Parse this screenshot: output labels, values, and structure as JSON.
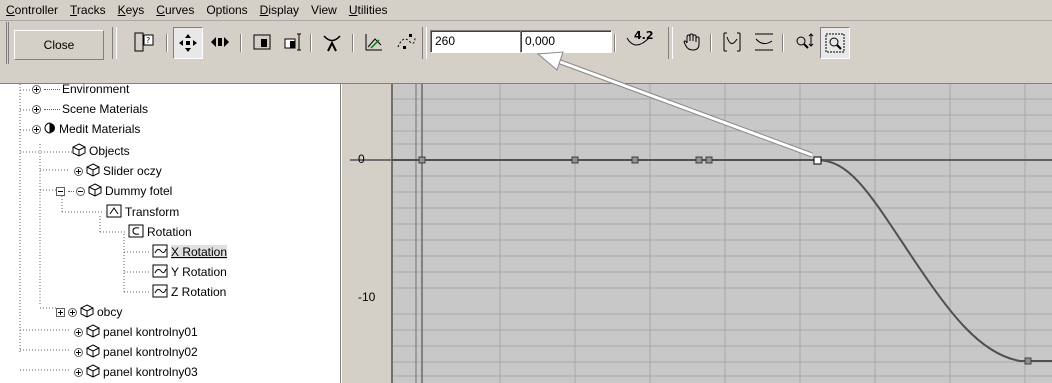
{
  "menu": {
    "items": [
      {
        "label": "Controller",
        "u": "C",
        "rest": "ontroller"
      },
      {
        "label": "Tracks",
        "u": "T",
        "rest": "racks"
      },
      {
        "label": "Keys",
        "u": "K",
        "rest": "eys"
      },
      {
        "label": "Curves",
        "u": "C",
        "rest": "urves"
      },
      {
        "label": "Options",
        "u": "",
        "rest": "Options"
      },
      {
        "label": "Display",
        "u": "D",
        "rest": "isplay"
      },
      {
        "label": "View",
        "u": "",
        "rest": "View"
      },
      {
        "label": "Utilities",
        "u": "U",
        "rest": "tilities"
      }
    ]
  },
  "toolbar": {
    "close_label": "Close",
    "frame_value": "260",
    "value_field": "0,000",
    "snap_value": "4.2"
  },
  "tree": {
    "nodes": [
      {
        "label": "Environment"
      },
      {
        "label": "Scene Materials"
      },
      {
        "label": "Medit Materials"
      },
      {
        "label": "Objects"
      },
      {
        "label": "Slider oczy"
      },
      {
        "label": "Dummy fotel"
      },
      {
        "label": "Transform"
      },
      {
        "label": "Rotation"
      },
      {
        "label": "X Rotation"
      },
      {
        "label": "Y Rotation"
      },
      {
        "label": "Z Rotation"
      },
      {
        "label": "obcy"
      },
      {
        "label": "panel kontrolny01"
      },
      {
        "label": "panel kontrolny02"
      },
      {
        "label": "panel kontrolny03"
      }
    ]
  },
  "graph": {
    "y_labels": {
      "zero": "0",
      "minus10": "-10"
    }
  },
  "colors": {
    "curve": "#505050",
    "grid": "#a0a0a0",
    "background": "#d4d0c8",
    "arrow": "#ffffff"
  }
}
